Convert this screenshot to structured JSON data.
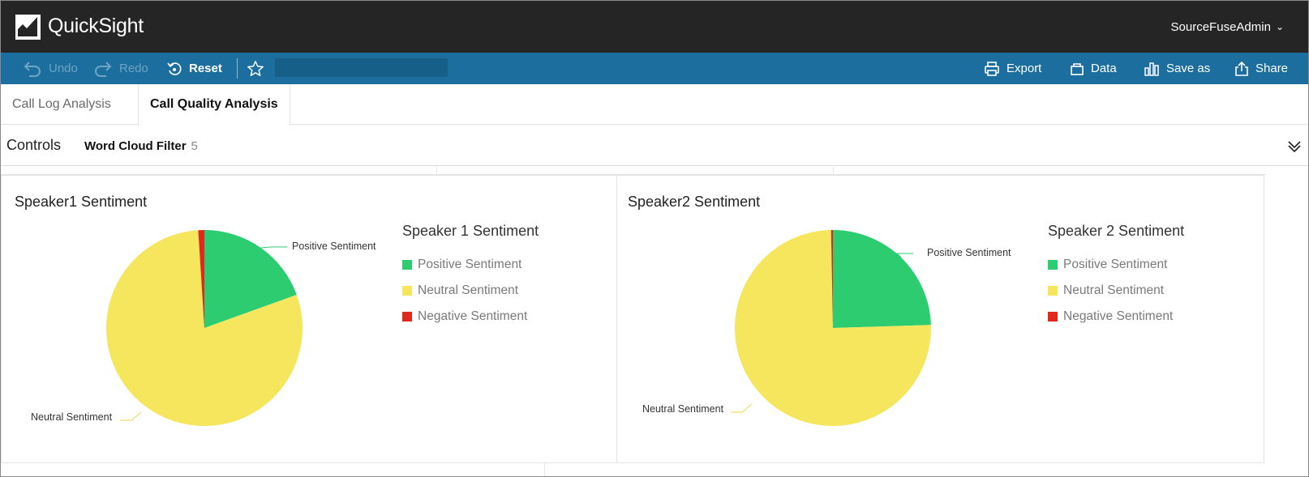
{
  "app": {
    "brand": "QuickSight",
    "user": "SourceFuseAdmin"
  },
  "toolbar": {
    "undo": "Undo",
    "redo": "Redo",
    "reset": "Reset",
    "export": "Export",
    "data": "Data",
    "save_as": "Save as",
    "share": "Share"
  },
  "tabs": [
    {
      "label": "Call Log Analysis"
    },
    {
      "label": "Call Quality Analysis",
      "active": true
    }
  ],
  "controls": {
    "label": "Controls",
    "filter_label": "Word Cloud Filter",
    "filter_count": "5"
  },
  "colors": {
    "positive": "#2ecc71",
    "neutral": "#f5e65e",
    "negative": "#e0281e",
    "topbar": "#252526",
    "toolbar": "#1c6e9e"
  },
  "visuals": [
    {
      "title": "Speaker1 Sentiment",
      "legend_title": "Speaker 1 Sentiment",
      "legend": [
        "Positive Sentiment",
        "Neutral Sentiment",
        "Negative Sentiment"
      ],
      "labels": {
        "positive": "Positive Sentiment",
        "neutral": "Neutral Sentiment"
      }
    },
    {
      "title": "Speaker2 Sentiment",
      "legend_title": "Speaker 2 Sentiment",
      "legend": [
        "Positive Sentiment",
        "Neutral Sentiment",
        "Negative Sentiment"
      ],
      "labels": {
        "positive": "Positive Sentiment",
        "neutral": "Neutral Sentiment"
      }
    }
  ],
  "chart_data": [
    {
      "type": "pie",
      "title": "Speaker1 Sentiment",
      "categories": [
        "Positive Sentiment",
        "Neutral Sentiment",
        "Negative Sentiment"
      ],
      "values": [
        19.5,
        79.5,
        1.0
      ],
      "colors": [
        "#2ecc71",
        "#f5e65e",
        "#e0281e"
      ],
      "legend_title": "Speaker 1 Sentiment"
    },
    {
      "type": "pie",
      "title": "Speaker2 Sentiment",
      "categories": [
        "Positive Sentiment",
        "Neutral Sentiment",
        "Negative Sentiment"
      ],
      "values": [
        24.5,
        75.2,
        0.3
      ],
      "colors": [
        "#2ecc71",
        "#f5e65e",
        "#e0281e"
      ],
      "legend_title": "Speaker 2 Sentiment"
    }
  ]
}
